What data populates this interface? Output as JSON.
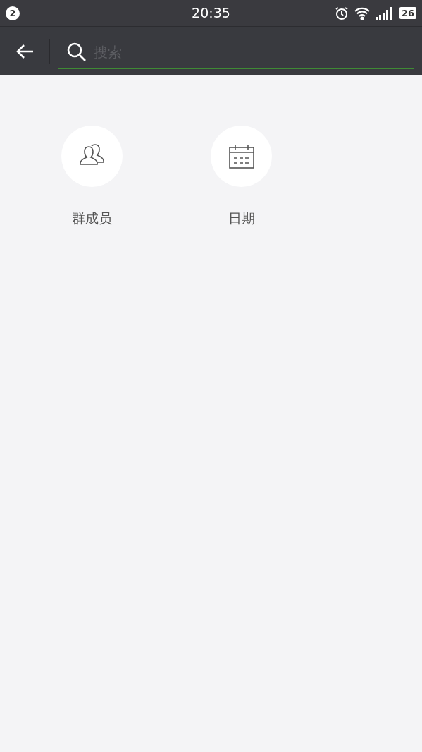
{
  "status_bar": {
    "notification_count": "2",
    "time": "20:35",
    "battery": "26"
  },
  "search": {
    "placeholder": "搜索"
  },
  "options": [
    {
      "kind": "members",
      "label": "群成员"
    },
    {
      "kind": "date",
      "label": "日期"
    }
  ]
}
